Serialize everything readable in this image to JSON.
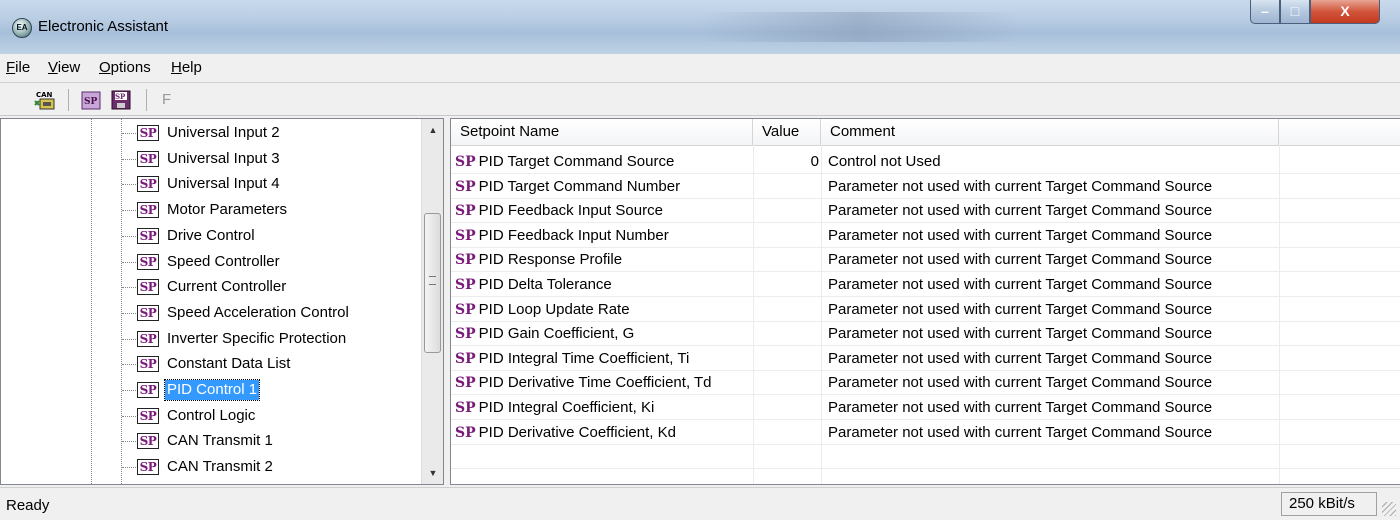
{
  "window": {
    "title": "Electronic Assistant",
    "app_icon_text": "EA"
  },
  "titlebar_buttons": {
    "minimize": "–",
    "maximize": "□",
    "close": "X"
  },
  "menu": [
    {
      "label": "File",
      "mnemonic": "F",
      "rest": "ile"
    },
    {
      "label": "View",
      "mnemonic": "V",
      "rest": "iew"
    },
    {
      "label": "Options",
      "mnemonic": "O",
      "rest": "ptions"
    },
    {
      "label": "Help",
      "mnemonic": "H",
      "rest": "elp"
    }
  ],
  "toolbar": {
    "f_label": "F",
    "can_icon_text": "CAN",
    "sp_icon_text": "SP"
  },
  "tree": {
    "icon_text": "SP",
    "items": [
      {
        "label": "Universal Input 2"
      },
      {
        "label": "Universal Input 3"
      },
      {
        "label": "Universal Input 4"
      },
      {
        "label": "Motor Parameters"
      },
      {
        "label": "Drive Control"
      },
      {
        "label": "Speed Controller"
      },
      {
        "label": "Current Controller"
      },
      {
        "label": "Speed Acceleration Control"
      },
      {
        "label": "Inverter Specific Protection"
      },
      {
        "label": "Constant Data List"
      },
      {
        "label": "PID Control 1",
        "selected": true
      },
      {
        "label": "Control Logic"
      },
      {
        "label": "CAN Transmit 1"
      },
      {
        "label": "CAN Transmit 2"
      }
    ],
    "scroll_up": "▲",
    "scroll_down": "▼"
  },
  "list": {
    "columns": {
      "name": "Setpoint Name",
      "value": "Value",
      "comment": "Comment"
    },
    "prefix": "SP",
    "rows": [
      {
        "name": "PID Target Command Source",
        "value": "0",
        "comment": "Control not Used"
      },
      {
        "name": "PID Target Command Number",
        "value": "",
        "comment": "Parameter not used with current Target Command Source"
      },
      {
        "name": "PID Feedback Input Source",
        "value": "",
        "comment": "Parameter not used with current Target Command Source"
      },
      {
        "name": "PID Feedback Input Number",
        "value": "",
        "comment": "Parameter not used with current Target Command Source"
      },
      {
        "name": "PID Response Profile",
        "value": "",
        "comment": "Parameter not used with current Target Command Source"
      },
      {
        "name": "PID Delta Tolerance",
        "value": "",
        "comment": "Parameter not used with current Target Command Source"
      },
      {
        "name": "PID Loop Update Rate",
        "value": "",
        "comment": "Parameter not used with current Target Command Source"
      },
      {
        "name": "PID Gain Coefficient, G",
        "value": "",
        "comment": "Parameter not used with current Target Command Source"
      },
      {
        "name": "PID Integral Time Coefficient, Ti",
        "value": "",
        "comment": "Parameter not used with current Target Command Source"
      },
      {
        "name": "PID Derivative Time Coefficient, Td",
        "value": "",
        "comment": "Parameter not used with current Target Command Source"
      },
      {
        "name": "PID Integral Coefficient, Ki",
        "value": "",
        "comment": "Parameter not used with current Target Command Source"
      },
      {
        "name": "PID Derivative Coefficient, Kd",
        "value": "",
        "comment": "Parameter not used with current Target Command Source"
      }
    ]
  },
  "status": {
    "text": "Ready",
    "baud": "250 kBit/s"
  }
}
